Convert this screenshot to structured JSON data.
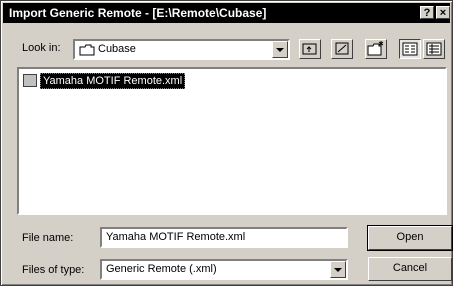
{
  "window": {
    "title": "Import Generic Remote - [E:\\Remote\\Cubase]",
    "help_label": "?",
    "close_label": "×"
  },
  "lookin": {
    "label": "Look in:",
    "value": "Cubase",
    "folder_icon": "folder-icon"
  },
  "toolbar": {
    "icons": [
      "up-folder-icon",
      "desktop-icon",
      "new-folder-icon",
      "list-view-icon",
      "details-view-icon"
    ]
  },
  "files": [
    {
      "name": "Yamaha MOTIF Remote.xml",
      "icon": "xml-file-icon",
      "selected": true
    }
  ],
  "filename": {
    "label": "File name:",
    "value": "Yamaha MOTIF Remote.xml"
  },
  "filetype": {
    "label": "Files of type:",
    "value": "Generic Remote (.xml)"
  },
  "buttons": {
    "open": "Open",
    "cancel": "Cancel"
  }
}
